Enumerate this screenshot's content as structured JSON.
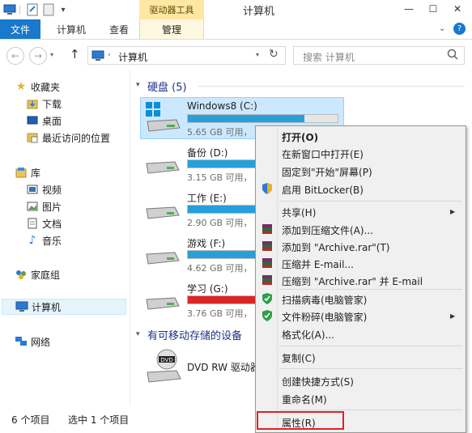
{
  "titlebar": {
    "drive_tools": "驱动器工具",
    "window_title": "计算机",
    "icons": [
      "computer-icon",
      "properties-icon",
      "new-folder-icon",
      "quick-access-dropdown-icon"
    ]
  },
  "ribbon": {
    "tabs": [
      "文件",
      "计算机",
      "查看",
      "管理"
    ]
  },
  "address": {
    "path": "计算机",
    "search_placeholder": "搜索 计算机"
  },
  "nav": {
    "favorites": "收藏夹",
    "downloads": "下载",
    "desktop": "桌面",
    "recent": "最近访问的位置",
    "libraries": "库",
    "videos": "视频",
    "pictures": "图片",
    "documents": "文档",
    "music": "音乐",
    "homegroup": "家庭组",
    "computer": "计算机",
    "network": "网络"
  },
  "content": {
    "hdd_header": "硬盘 (5)",
    "removable_header": "有可移动存储的设备",
    "drives": [
      {
        "name": "Windows8 (C:)",
        "free": "5.65 GB 可用，",
        "used_fraction": 0.78,
        "bar_color": "#26a0da"
      },
      {
        "name": "备份 (D:)",
        "free": "3.15 GB 可用，",
        "used_fraction": 0.95,
        "bar_color": "#26a0da"
      },
      {
        "name": "工作 (E:)",
        "free": "2.90 GB 可用，",
        "used_fraction": 0.95,
        "bar_color": "#26a0da"
      },
      {
        "name": "游戏 (F:)",
        "free": "4.62 GB 可用，",
        "used_fraction": 0.92,
        "bar_color": "#26a0da"
      },
      {
        "name": "学习 (G:)",
        "free": "3.76 GB 可用，",
        "used_fraction": 0.96,
        "bar_color": "#da2626"
      }
    ],
    "dvd_name": "DVD RW 驱动器"
  },
  "status": {
    "item_count": "6 个项目",
    "selected": "选中 1 个项目"
  },
  "context_menu": {
    "open": "打开(O)",
    "open_new_window": "在新窗口中打开(E)",
    "pin_start": "固定到\"开始\"屏幕(P)",
    "bitlocker": "启用 BitLocker(B)",
    "share": "共享(H)",
    "add_archive": "添加到压缩文件(A)...",
    "add_archive_rar": "添加到 \"Archive.rar\"(T)",
    "compress_email": "压缩并 E-mail...",
    "compress_rar_email": "压缩到 \"Archive.rar\" 并 E-mail",
    "scan_virus": "扫描病毒(电脑管家)",
    "shred": "文件粉碎(电脑管家)",
    "format": "格式化(A)...",
    "copy": "复制(C)",
    "create_shortcut": "创建快捷方式(S)",
    "rename": "重命名(M)",
    "properties": "属性(R)"
  },
  "colors": {
    "accent": "#1979ca",
    "drive_bar_normal": "#26a0da",
    "drive_bar_full": "#da2626",
    "highlight": "#dd2222"
  }
}
